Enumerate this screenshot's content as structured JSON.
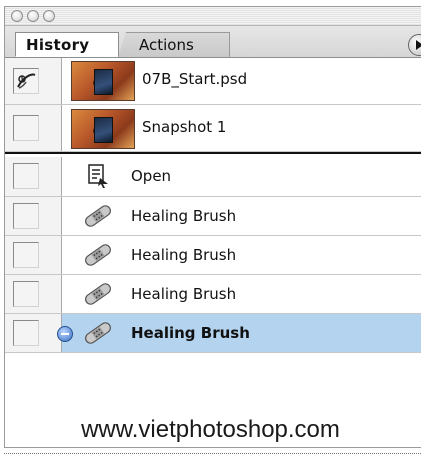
{
  "window": {
    "tabs": [
      {
        "label": "History",
        "active": true
      },
      {
        "label": "Actions",
        "active": false
      }
    ]
  },
  "snapshots": [
    {
      "label": "07B_Start.psd",
      "icon": "history-brush-icon"
    },
    {
      "label": "Snapshot 1",
      "icon": null
    }
  ],
  "states": [
    {
      "label": "Open",
      "icon": "open-document-icon",
      "selected": false
    },
    {
      "label": "Healing Brush",
      "icon": "healing-brush-icon",
      "selected": false
    },
    {
      "label": "Healing Brush",
      "icon": "healing-brush-icon",
      "selected": false
    },
    {
      "label": "Healing Brush",
      "icon": "healing-brush-icon",
      "selected": false
    },
    {
      "label": "Healing Brush",
      "icon": "healing-brush-icon",
      "selected": true
    }
  ],
  "watermark": "www.vietphotoshop.com",
  "colors": {
    "selection": "#b4d3ee",
    "thumbnail_tone": "#b9582a"
  }
}
